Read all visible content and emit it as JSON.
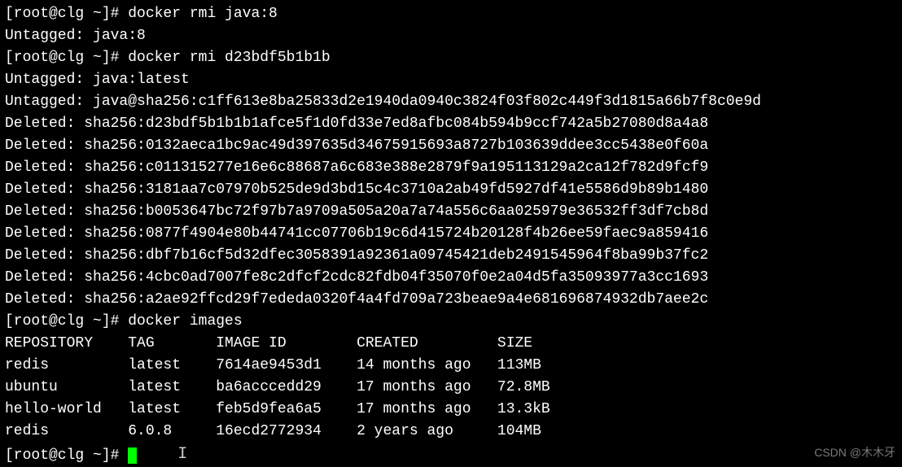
{
  "lines": [
    {
      "type": "cmd",
      "prompt": "[root@clg ~]# ",
      "command": "docker rmi java:8"
    },
    {
      "type": "out",
      "text": "Untagged: java:8"
    },
    {
      "type": "cmd",
      "prompt": "[root@clg ~]# ",
      "command": "docker rmi d23bdf5b1b1b"
    },
    {
      "type": "out",
      "text": "Untagged: java:latest"
    },
    {
      "type": "out",
      "text": "Untagged: java@sha256:c1ff613e8ba25833d2e1940da0940c3824f03f802c449f3d1815a66b7f8c0e9d"
    },
    {
      "type": "out",
      "text": "Deleted: sha256:d23bdf5b1b1b1afce5f1d0fd33e7ed8afbc084b594b9ccf742a5b27080d8a4a8"
    },
    {
      "type": "out",
      "text": "Deleted: sha256:0132aeca1bc9ac49d397635d34675915693a8727b103639ddee3cc5438e0f60a"
    },
    {
      "type": "out",
      "text": "Deleted: sha256:c011315277e16e6c88687a6c683e388e2879f9a195113129a2ca12f782d9fcf9"
    },
    {
      "type": "out",
      "text": "Deleted: sha256:3181aa7c07970b525de9d3bd15c4c3710a2ab49fd5927df41e5586d9b89b1480"
    },
    {
      "type": "out",
      "text": "Deleted: sha256:b0053647bc72f97b7a9709a505a20a7a74a556c6aa025979e36532ff3df7cb8d"
    },
    {
      "type": "out",
      "text": "Deleted: sha256:0877f4904e80b44741cc07706b19c6d415724b20128f4b26ee59faec9a859416"
    },
    {
      "type": "out",
      "text": "Deleted: sha256:dbf7b16cf5d32dfec3058391a92361a09745421deb2491545964f8ba99b37fc2"
    },
    {
      "type": "out",
      "text": "Deleted: sha256:4cbc0ad7007fe8c2dfcf2cdc82fdb04f35070f0e2a04d5fa35093977a3cc1693"
    },
    {
      "type": "out",
      "text": "Deleted: sha256:a2ae92ffcd29f7ededa0320f4a4fd709a723beae9a4e681696874932db7aee2c"
    },
    {
      "type": "cmd",
      "prompt": "[root@clg ~]# ",
      "command": "docker images"
    }
  ],
  "table": {
    "headers": [
      "REPOSITORY",
      "TAG",
      "IMAGE ID",
      "CREATED",
      "SIZE"
    ],
    "rows": [
      [
        "redis",
        "latest",
        "7614ae9453d1",
        "14 months ago",
        "113MB"
      ],
      [
        "ubuntu",
        "latest",
        "ba6acccedd29",
        "17 months ago",
        "72.8MB"
      ],
      [
        "hello-world",
        "latest",
        "feb5d9fea6a5",
        "17 months ago",
        "13.3kB"
      ],
      [
        "redis",
        "6.0.8",
        "16ecd2772934",
        "2 years ago",
        "104MB"
      ]
    ]
  },
  "final_prompt": "[root@clg ~]# ",
  "watermark": "CSDN @木木牙"
}
